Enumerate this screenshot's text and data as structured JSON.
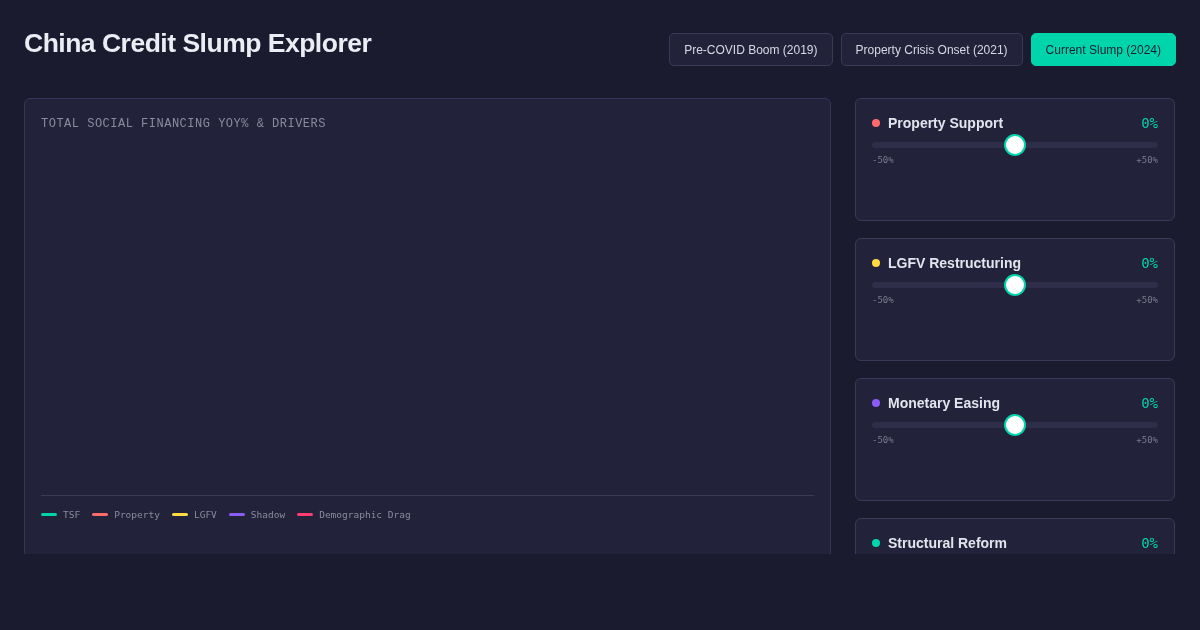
{
  "title": "China Credit Slump Explorer",
  "scenarios": [
    {
      "label": "Pre-COVID Boom (2019)",
      "selected": false
    },
    {
      "label": "Property Crisis Onset (2021)",
      "selected": false
    },
    {
      "label": "Current Slump (2024)",
      "selected": true
    }
  ],
  "chart_panel": {
    "title": "TOTAL SOCIAL FINANCING YOY% & DRIVERS",
    "legend": [
      {
        "label": "TSF",
        "color": "#00d4aa"
      },
      {
        "label": "Property",
        "color": "#ff6b6b"
      },
      {
        "label": "LGFV",
        "color": "#ffd93d"
      },
      {
        "label": "Shadow",
        "color": "#8b5cf6"
      },
      {
        "label": "Demographic Drag",
        "color": "#ff3d71"
      }
    ]
  },
  "levers": [
    {
      "name": "Property Support",
      "color": "#ff6b6b",
      "reading": "0%",
      "level": 0.5,
      "min_label": "-50%",
      "max_label": "+50%"
    },
    {
      "name": "LGFV Restructuring",
      "color": "#ffd93d",
      "reading": "0%",
      "level": 0.5,
      "min_label": "-50%",
      "max_label": "+50%"
    },
    {
      "name": "Monetary Easing",
      "color": "#8b5cf6",
      "reading": "0%",
      "level": 0.5,
      "min_label": "-50%",
      "max_label": "+50%"
    },
    {
      "name": "Structural Reform",
      "color": "#00d4aa",
      "reading": "0%"
    }
  ]
}
